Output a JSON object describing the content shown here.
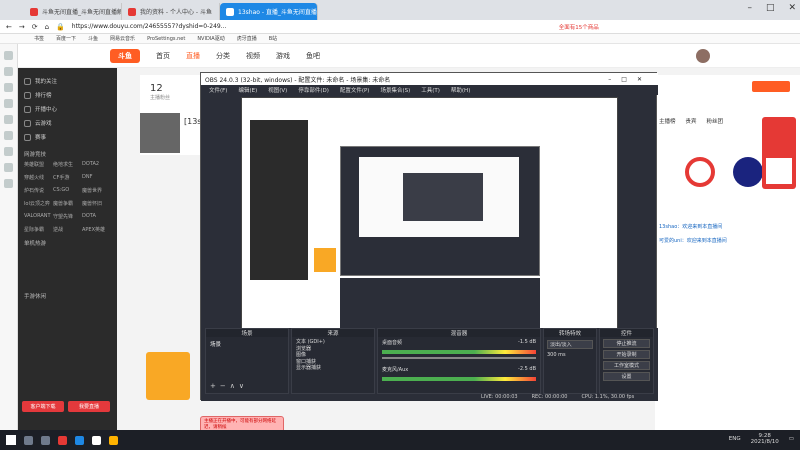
{
  "browser": {
    "tabs": [
      {
        "label": "斗鱼无间直播_斗鱼无间直播解说视频"
      },
      {
        "label": "我的资料 - 个人中心 - 斗鱼"
      },
      {
        "label": "13shao - 直播_斗鱼无间直播_斗鱼"
      }
    ],
    "address": "https://www.douyu.com/24655557?dyshid=0-249...",
    "bookmarks": [
      "书签",
      "百度一下",
      "斗鱼",
      "网易云音乐",
      "ProSettings.net",
      "NVIDIA驱动",
      "虎牙直播",
      "B站"
    ],
    "search_hint": "全面有15个商品"
  },
  "douyu": {
    "logo": "斗鱼",
    "nav": [
      "首页",
      "直播",
      "分类",
      "视频",
      "游戏",
      "鱼吧"
    ],
    "sidebar": {
      "items": [
        "我的关注",
        "排行榜",
        "开播中心",
        "云游戏",
        "赛事"
      ],
      "section1": "网游竞技",
      "games": [
        "英雄联盟",
        "绝地求生",
        "DOTA2",
        "穿越火线",
        "CF手游",
        "DNF",
        "炉石传说",
        "CS:GO",
        "魔兽世界",
        "lol云顶之弈",
        "魔兽争霸",
        "魔兽怀旧",
        "VALORANT",
        "守望先锋",
        "DOTA",
        "星际争霸",
        "逆战",
        "APEX英雄"
      ],
      "section2": "单机热游",
      "section3": "手游休闲",
      "btn_client": "客户端下载",
      "btn_live": "我要直播"
    },
    "up": {
      "followers": "12",
      "follow_label": "主播粉丝",
      "room_name": "[13sha"
    },
    "right": {
      "tabs": [
        "主播榜",
        "贵宾",
        "粉丝团"
      ],
      "chat1": "13shao：欢迎来到本直播间",
      "chat2": "可爱的uni：欢迎来到本直播间"
    }
  },
  "obs": {
    "title": "OBS 24.0.3 (32-bit, windows) - 配置文件: 未命名 - 场景集: 未命名",
    "menu": [
      "文件(F)",
      "编辑(E)",
      "视图(V)",
      "停靠部件(D)",
      "配置文件(P)",
      "场景集合(S)",
      "工具(T)",
      "帮助(H)"
    ],
    "docks": {
      "scenes": "场景",
      "sources": "来源",
      "mixer": "混音器",
      "transitions": "转场特效",
      "controls": "控件"
    },
    "scene_items": [
      "场景"
    ],
    "source_items": [
      "文本 (GDI+)",
      "浏览器",
      "图像",
      "窗口捕获",
      "显示器捕获"
    ],
    "mixer": {
      "ch1": "桌面音频",
      "ch1_db": "-1.5 dB",
      "ch2": "麦克风/Aux",
      "ch2_db": "-2.5 dB"
    },
    "transition": {
      "mode": "淡出/淡入",
      "duration": "300 ms"
    },
    "controls": [
      "停止推流",
      "开始录制",
      "工作室模式",
      "设置",
      "退出"
    ],
    "status": {
      "live": "LIVE: 00:00:03",
      "rec": "REC: 00:00:00",
      "cpu": "CPU: 1.1%, 30.00 fps"
    }
  },
  "toast": "主播正在开播中，可能有部分网络延迟，请稍候",
  "taskbar": {
    "lang": "ENG",
    "time": "9:28",
    "date": "2021/8/10"
  },
  "colors": {
    "accent": "#ff5d23",
    "tab_active": "#1e88e5",
    "obs_bg": "#2b2e38"
  }
}
